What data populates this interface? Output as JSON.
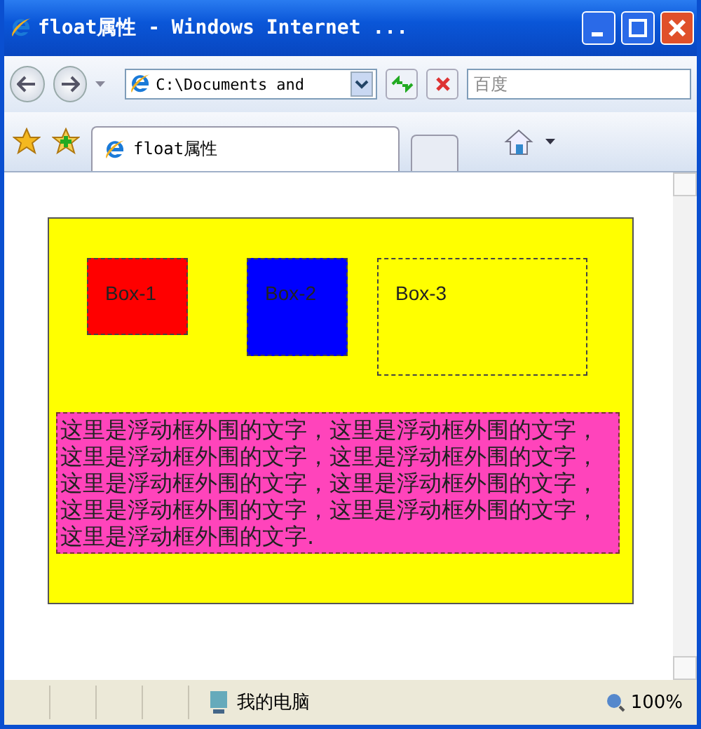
{
  "window": {
    "title": "float属性 - Windows Internet ..."
  },
  "toolbar": {
    "address": "C:\\Documents and",
    "search_placeholder": "百度"
  },
  "tabs": [
    {
      "label": "float属性",
      "selected": true
    }
  ],
  "page": {
    "boxes": [
      {
        "label": "Box-1",
        "color": "#ff0000"
      },
      {
        "label": "Box-2",
        "color": "#0000ff"
      },
      {
        "label": "Box-3",
        "color": "#ffff00"
      }
    ],
    "paragraph": "这里是浮动框外围的文字，这里是浮动框外围的文字，这里是浮动框外围的文字，这里是浮动框外围的文字，这里是浮动框外围的文字，这里是浮动框外围的文字，这里是浮动框外围的文字，这里是浮动框外围的文字，这里是浮动框外围的文字."
  },
  "status_bar": {
    "zone": "我的电脑",
    "zoom": "100%"
  }
}
